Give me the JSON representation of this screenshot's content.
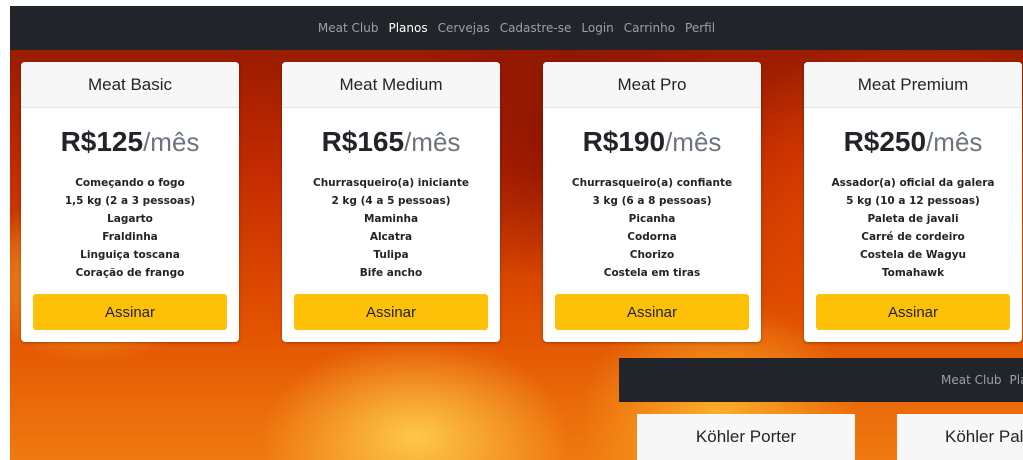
{
  "nav": {
    "items": [
      {
        "label": "Meat Club",
        "active": false
      },
      {
        "label": "Planos",
        "active": true
      },
      {
        "label": "Cervejas",
        "active": false
      },
      {
        "label": "Cadastre-se",
        "active": false
      },
      {
        "label": "Login",
        "active": false
      },
      {
        "label": "Carrinho",
        "active": false
      },
      {
        "label": "Perfil",
        "active": false
      }
    ]
  },
  "plans": [
    {
      "name": "Meat Basic",
      "price": "R$125",
      "period": "/mês",
      "features": [
        "Começando o fogo",
        "1,5 kg (2 a 3 pessoas)",
        "Lagarto",
        "Fraldinha",
        "Linguiça toscana",
        "Coração de frango"
      ],
      "button": "Assinar"
    },
    {
      "name": "Meat Medium",
      "price": "R$165",
      "period": "/mês",
      "features": [
        "Churrasqueiro(a) iniciante",
        "2 kg (4 a 5 pessoas)",
        "Maminha",
        "Alcatra",
        "Tulipa",
        "Bife ancho"
      ],
      "button": "Assinar"
    },
    {
      "name": "Meat Pro",
      "price": "R$190",
      "period": "/mês",
      "features": [
        "Churrasqueiro(a) confiante",
        "3 kg (6 a 8 pessoas)",
        "Picanha",
        "Codorna",
        "Chorizo",
        "Costela em tiras"
      ],
      "button": "Assinar"
    },
    {
      "name": "Meat Premium",
      "price": "R$250",
      "period": "/mês",
      "features": [
        "Assador(a) oficial da galera",
        "5 kg (10 a 12 pessoas)",
        "Paleta de javali",
        "Carré de cordeiro",
        "Costela de Wagyu",
        "Tomahawk"
      ],
      "button": "Assinar"
    }
  ],
  "overlay": {
    "nav_items": [
      "Meat Club",
      "Pla"
    ],
    "cards": [
      "Köhler Porter",
      "Köhler Pale"
    ]
  },
  "colors": {
    "navbar": "#212529",
    "button": "#ffc107",
    "active_link": "#ffffff",
    "link": "#9aa0a6"
  }
}
